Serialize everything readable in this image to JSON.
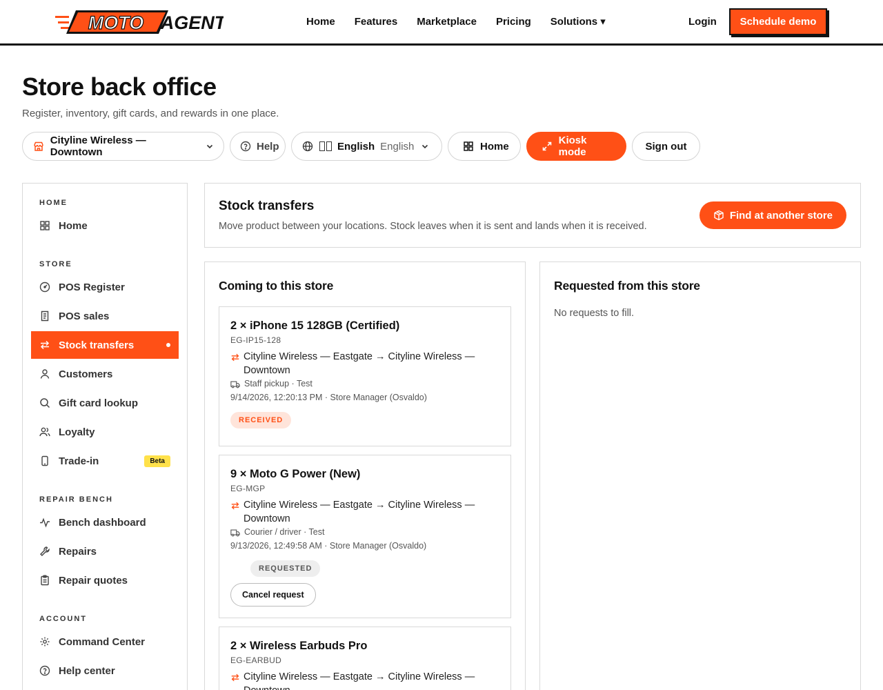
{
  "brand": {
    "logo_moto": "MOTO",
    "logo_agent": "AGENT",
    "accent": "#ff5016"
  },
  "nav": {
    "items": [
      "Home",
      "Features",
      "Marketplace",
      "Pricing",
      "Solutions ▾"
    ],
    "login": "Login",
    "cta": "Schedule demo"
  },
  "page": {
    "title": "Store back office",
    "subtitle": "Register, inventory, gift cards, and rewards in one place."
  },
  "toolbar": {
    "store": "Cityline Wireless — Downtown",
    "help": "Help",
    "lang_label": "English",
    "lang_native": "English",
    "home": "Home",
    "kiosk": "Kiosk mode",
    "signout": "Sign out"
  },
  "sidebar": {
    "sections": [
      "HOME",
      "STORE",
      "REPAIR BENCH",
      "ACCOUNT"
    ],
    "items": [
      {
        "label": "Home",
        "icon": "grid-icon"
      },
      {
        "label": "POS Register",
        "icon": "gauge-icon"
      },
      {
        "label": "POS sales",
        "icon": "receipt-icon"
      },
      {
        "label": "Stock transfers",
        "icon": "arrows-swap-icon",
        "active": true
      },
      {
        "label": "Customers",
        "icon": "user-icon"
      },
      {
        "label": "Gift card lookup",
        "icon": "search-icon"
      },
      {
        "label": "Loyalty",
        "icon": "users-icon"
      },
      {
        "label": "Trade-in",
        "icon": "phone-icon",
        "badge": "Beta"
      },
      {
        "label": "Bench dashboard",
        "icon": "activity-icon"
      },
      {
        "label": "Repairs",
        "icon": "wrench-icon"
      },
      {
        "label": "Repair quotes",
        "icon": "clipboard-icon"
      },
      {
        "label": "Command Center",
        "icon": "gear-icon"
      },
      {
        "label": "Help center",
        "icon": "help-circle-icon"
      }
    ]
  },
  "header_card": {
    "title": "Stock transfers",
    "subtitle": "Move product between your locations. Stock leaves when it is sent and lands when it is received.",
    "find_button": "Find at another store"
  },
  "incoming": {
    "title": "Coming to this store",
    "cards": [
      {
        "title": "2 × iPhone 15 128GB (Certified)",
        "sku": "EG-IP15-128",
        "route": "Cityline Wireless — Eastgate → Cityline Wireless — Downtown",
        "ship": "Staff pickup · Test",
        "meta": "9/14/2026, 12:20:13 PM · Store Manager (Osvaldo)",
        "status": "RECEIVED"
      },
      {
        "title": "9 × Moto G Power (New)",
        "sku": "EG-MGP",
        "route": "Cityline Wireless — Eastgate → Cityline Wireless — Downtown",
        "ship": "Courier / driver · Test",
        "meta": "9/13/2026, 12:49:58 AM · Store Manager (Osvaldo)",
        "status": "REQUESTED",
        "action": "Cancel request"
      },
      {
        "title": "2 × Wireless Earbuds Pro",
        "sku": "EG-EARBUD",
        "route": "Cityline Wireless — Eastgate → Cityline Wireless — Downtown"
      }
    ]
  },
  "outgoing": {
    "title": "Requested from this store",
    "empty": "No requests to fill."
  }
}
